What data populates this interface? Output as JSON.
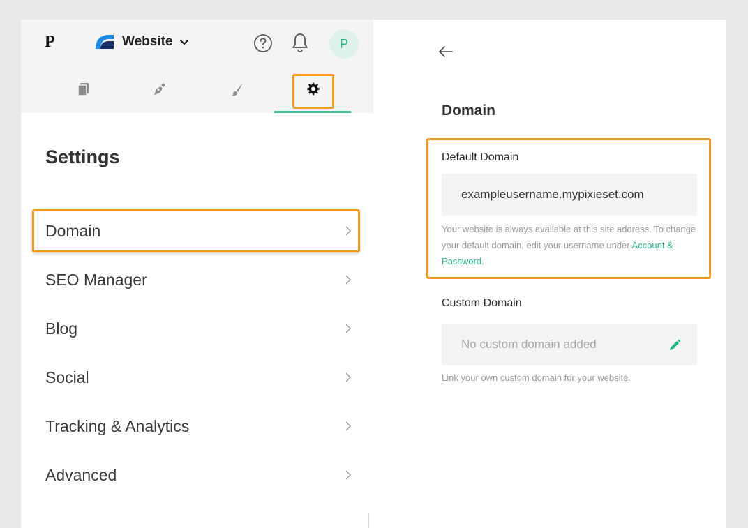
{
  "header": {
    "logo": "P",
    "site_name": "Website",
    "avatar_initial": "P"
  },
  "toolbar": {
    "icons": [
      "pages-icon",
      "pen-icon",
      "brush-icon",
      "gear-icon"
    ],
    "active": "gear-icon"
  },
  "settings": {
    "title": "Settings",
    "items": [
      {
        "label": "Domain"
      },
      {
        "label": "SEO Manager"
      },
      {
        "label": "Blog"
      },
      {
        "label": "Social"
      },
      {
        "label": "Tracking & Analytics"
      },
      {
        "label": "Advanced"
      }
    ]
  },
  "domain_page": {
    "title": "Domain",
    "default_domain": {
      "label": "Default Domain",
      "value": "exampleusername.mypixieset.com",
      "help_text": "Your website is always available at this site address. To change your default domain, edit your username under ",
      "link_text": "Account & Password."
    },
    "custom_domain": {
      "label": "Custom Domain",
      "placeholder": "No custom domain added",
      "help_text": "Link your own custom domain for your website."
    }
  },
  "colors": {
    "accent": "#2cb38a",
    "highlight": "#f59a1f",
    "panel_bg": "#f4f4f4"
  }
}
